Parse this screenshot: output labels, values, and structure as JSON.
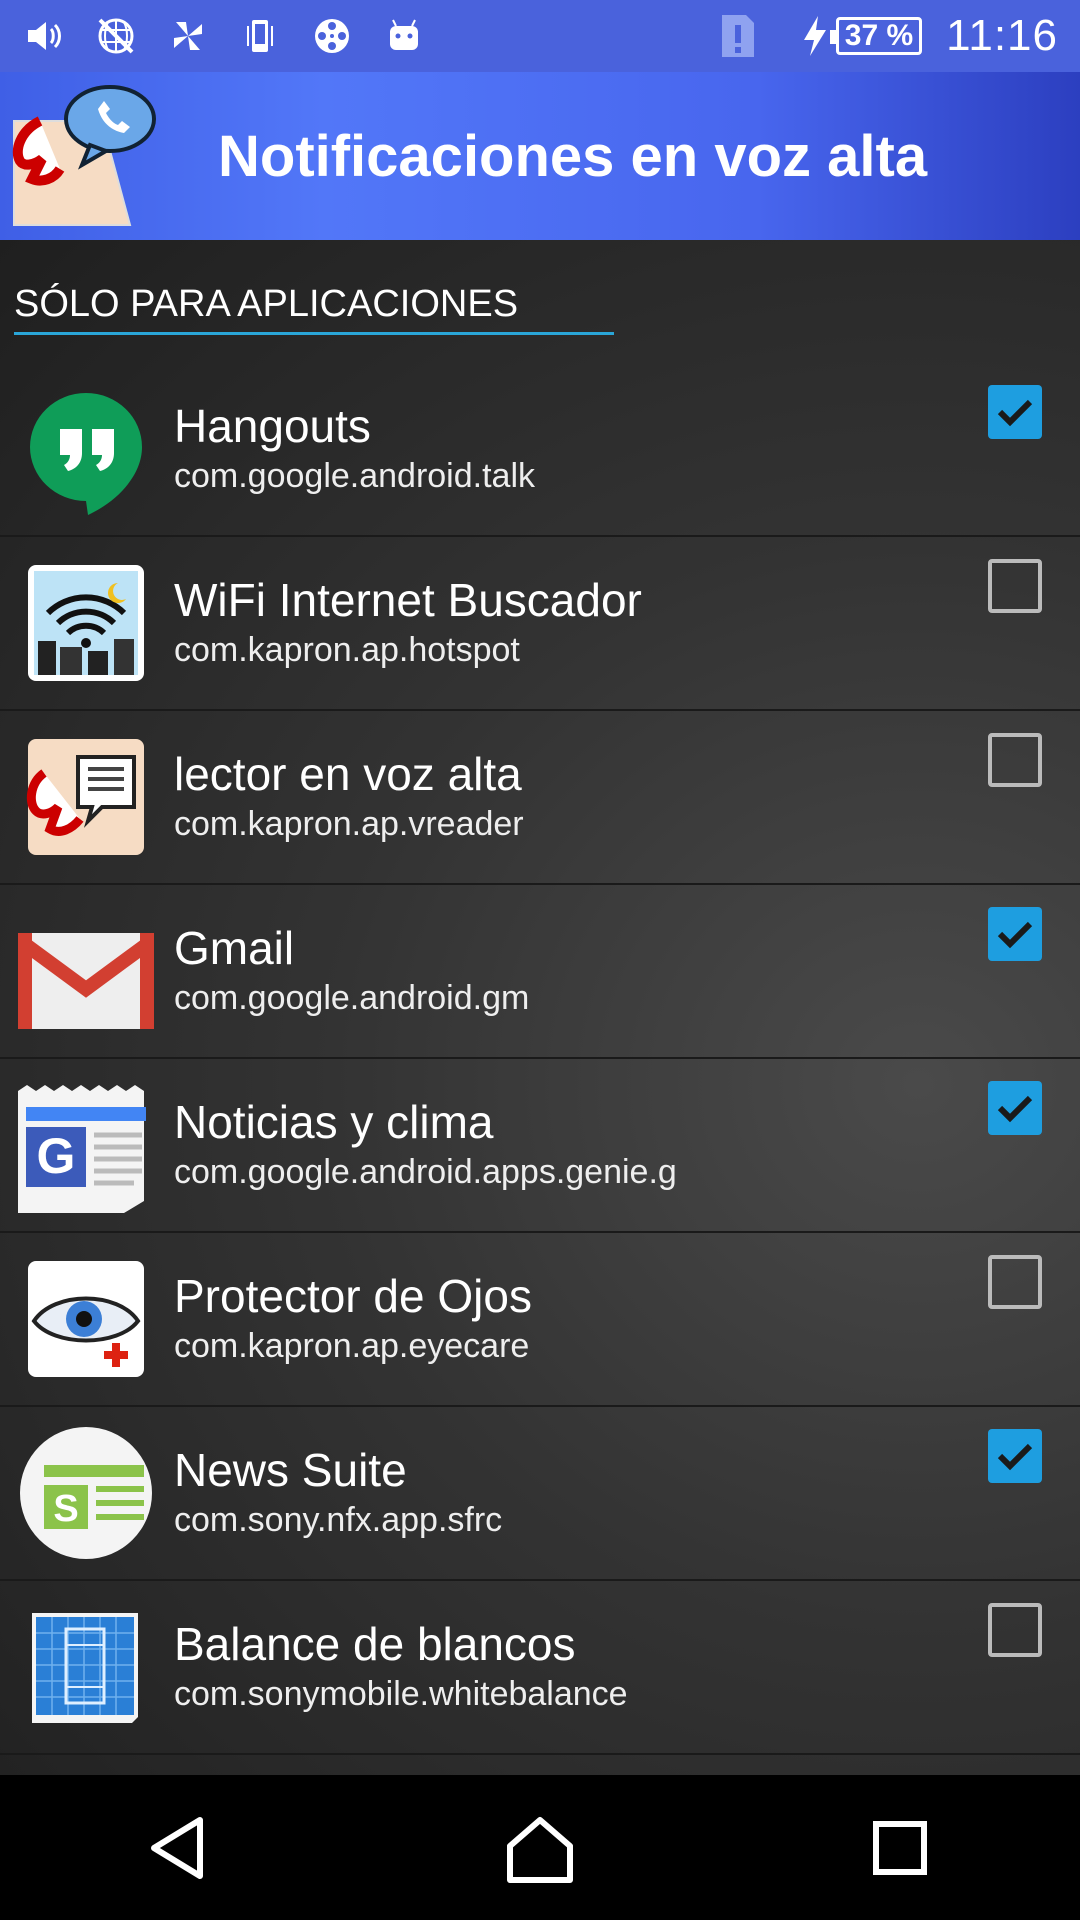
{
  "status_bar": {
    "icons": [
      "volume-icon",
      "no-network-icon",
      "wind-icon",
      "phone-data-icon",
      "film-reel-icon",
      "android-icon"
    ],
    "battery_percent": "37 %",
    "time": "11:16"
  },
  "app_bar": {
    "title": "Notificaciones en voz alta"
  },
  "section": {
    "header": "SÓLO PARA APLICACIONES"
  },
  "apps": [
    {
      "name": "Hangouts",
      "package": "com.google.android.talk",
      "checked": true,
      "icon": "hangouts-icon"
    },
    {
      "name": "WiFi Internet Buscador",
      "package": "com.kapron.ap.hotspot",
      "checked": false,
      "icon": "wifi-finder-icon"
    },
    {
      "name": "lector en voz alta",
      "package": "com.kapron.ap.vreader",
      "checked": false,
      "icon": "voice-reader-icon"
    },
    {
      "name": "Gmail",
      "package": "com.google.android.gm",
      "checked": true,
      "icon": "gmail-icon"
    },
    {
      "name": "Noticias y clima",
      "package": "com.google.android.apps.genie.g",
      "checked": true,
      "icon": "news-weather-icon"
    },
    {
      "name": "Protector de Ojos",
      "package": "com.kapron.ap.eyecare",
      "checked": false,
      "icon": "eye-protector-icon"
    },
    {
      "name": "News Suite",
      "package": "com.sony.nfx.app.sfrc",
      "checked": true,
      "icon": "news-suite-icon"
    },
    {
      "name": "Balance de blancos",
      "package": "com.sonymobile.whitebalance",
      "checked": false,
      "icon": "white-balance-icon"
    }
  ],
  "colors": {
    "status_bar": "#4a62dc",
    "app_bar": "#4866ee",
    "accent": "#1e9ee0",
    "section_underline": "#2aa6d8"
  }
}
